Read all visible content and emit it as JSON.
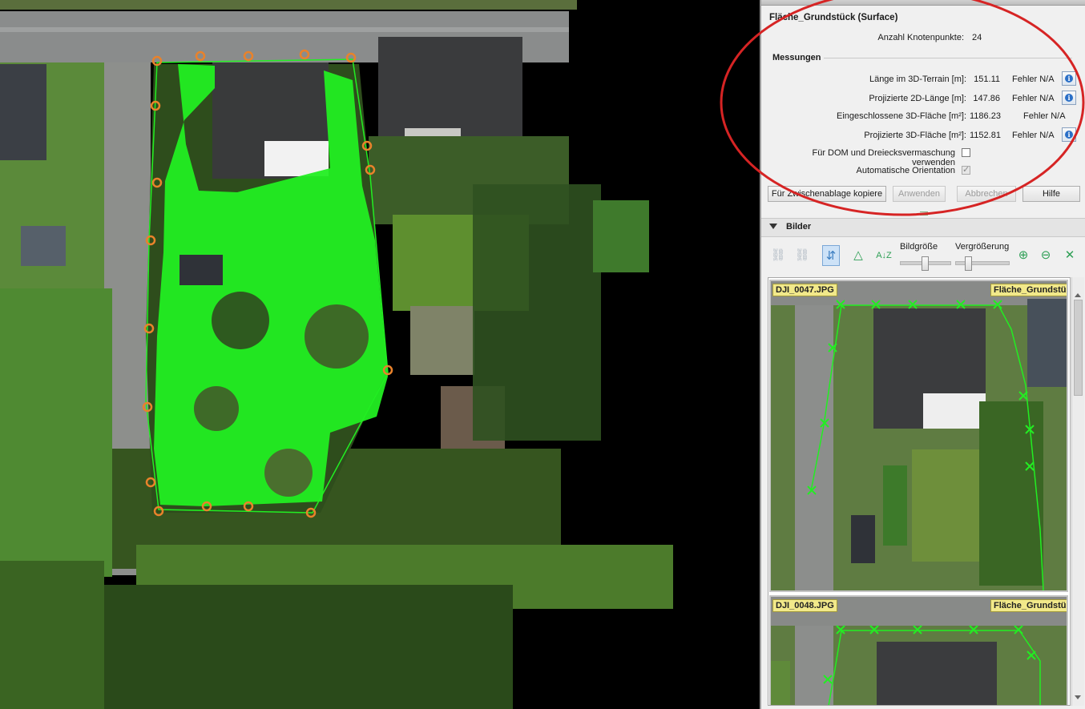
{
  "surface": {
    "title": "Fläche_Grundstück (Surface)",
    "node_count_label": "Anzahl Knotenpunkte:",
    "node_count": "24"
  },
  "measurements": {
    "section_title": "Messungen",
    "rows": [
      {
        "label": "Länge im 3D-Terrain [m]:",
        "value": "151.11",
        "error": "Fehler N/A"
      },
      {
        "label": "Projizierte 2D-Länge [m]:",
        "value": "147.86",
        "error": "Fehler N/A"
      },
      {
        "label": "Eingeschlossene 3D-Fläche [m²]:",
        "value": "1186.23",
        "error": "Fehler N/A"
      },
      {
        "label": "Projizierte 3D-Fläche [m²]:",
        "value": "1152.81",
        "error": "Fehler N/A"
      }
    ],
    "dom_label": "Für DOM und Dreiecksvermaschung verwenden",
    "dom_checked": false,
    "orientation_label": "Automatische Orientation",
    "orientation_checked": true
  },
  "buttons": {
    "copy": "Für Zwischenablage kopiere",
    "apply": "Anwenden",
    "cancel": "Abbrechen",
    "help": "Hilfe"
  },
  "images_panel": {
    "title": "Bilder",
    "image_size_label": "Bildgröße",
    "zoom_label": "Vergrößerung",
    "thumbnails": [
      {
        "file": "DJI_0047.JPG",
        "tag": "Fläche_Grundstüc"
      },
      {
        "file": "DJI_0048.JPG",
        "tag": "Fläche_Grundstüc"
      }
    ]
  },
  "colors": {
    "selection_green": "#22ee22",
    "vertex_orange": "#e9822b",
    "annotation_red": "#d62424"
  }
}
